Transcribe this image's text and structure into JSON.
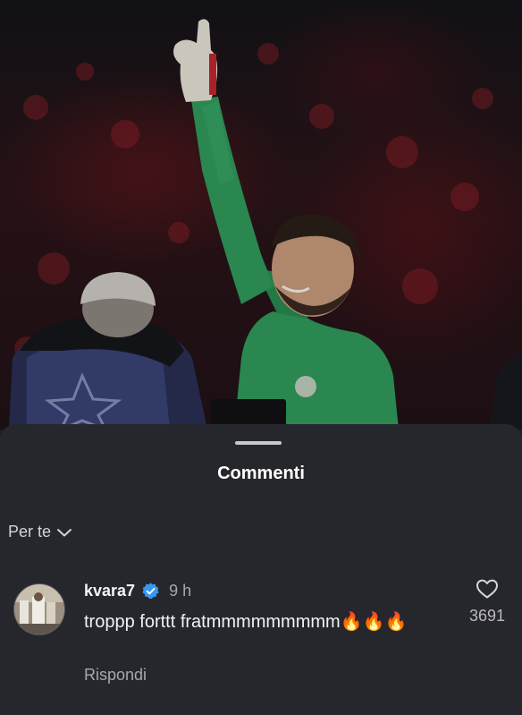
{
  "sheet": {
    "title": "Commenti",
    "sort_label": "Per te"
  },
  "comment": {
    "username": "kvara7",
    "verified": true,
    "time": "9 h",
    "text": "troppp forttt fratmmmmmmmmm🔥🔥🔥",
    "reply_label": "Rispondi",
    "like_count": "3691"
  },
  "colors": {
    "sheet_background": "#26272d",
    "verified_blue": "#3897f0",
    "jersey_green": "#2f9a5a"
  },
  "icons": [
    "chevron-down-icon",
    "verified-badge-icon",
    "heart-icon"
  ]
}
